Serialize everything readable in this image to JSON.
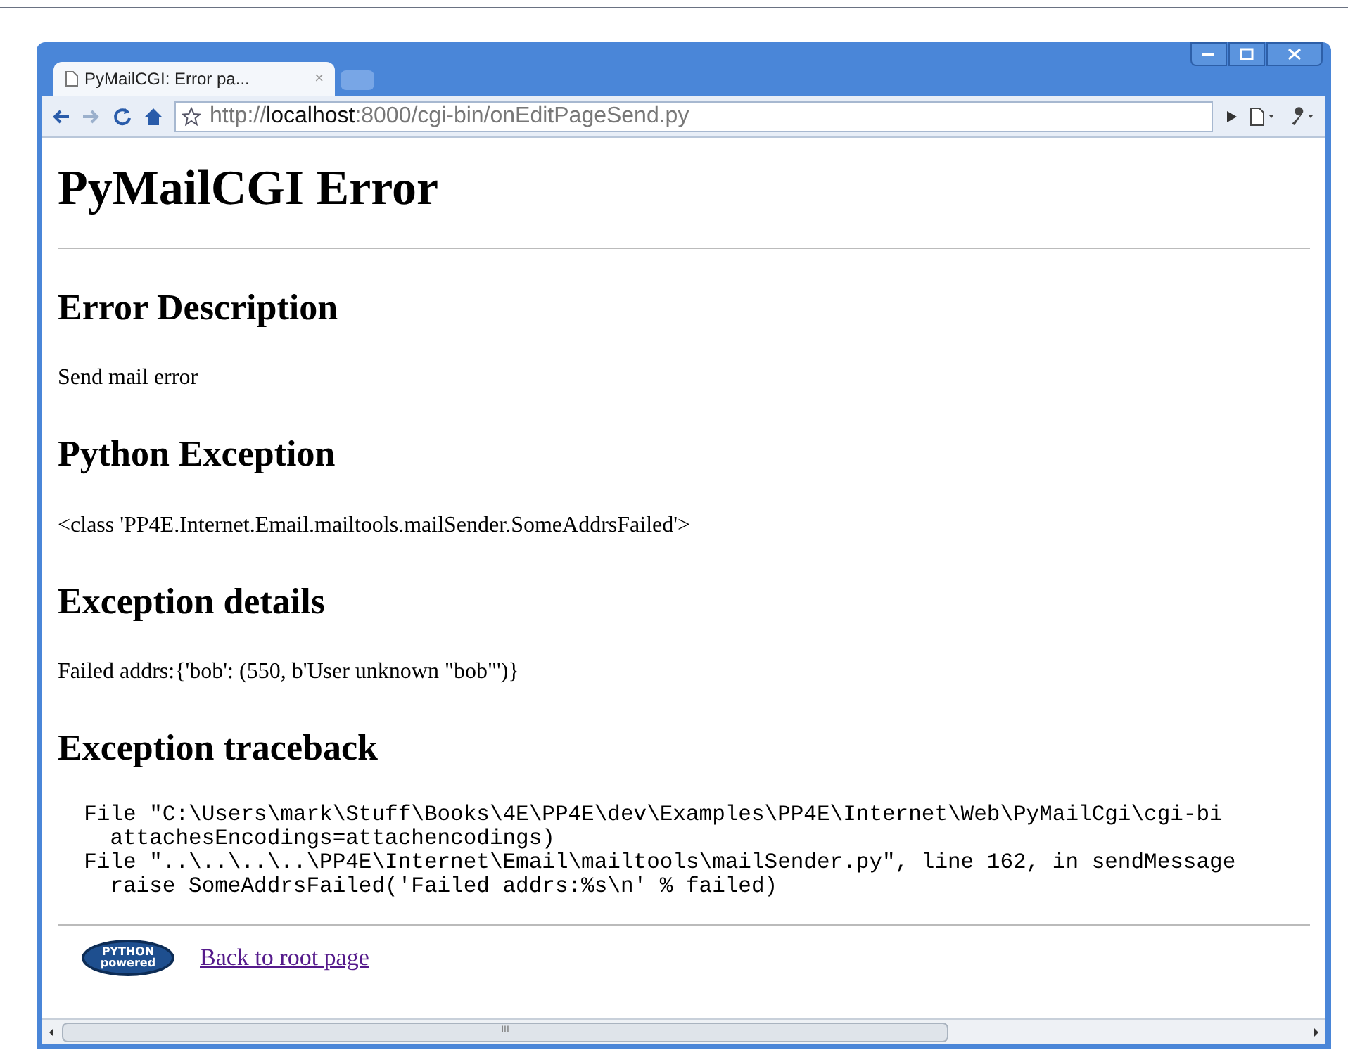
{
  "window": {
    "title": "PyMailCGI: Error pa...",
    "close": "×",
    "url": {
      "scheme": "http://",
      "host": "localhost",
      "path": ":8000/cgi-bin/onEditPageSend.py"
    }
  },
  "page": {
    "title": "PyMailCGI Error",
    "sections": [
      {
        "heading": "Error Description",
        "kind": "text",
        "body": [
          "Send mail error"
        ]
      },
      {
        "heading": "Python Exception",
        "kind": "text",
        "body": [
          "<class 'PP4E.Internet.Email.mailtools.mailSender.SomeAddrsFailed'>"
        ]
      },
      {
        "heading": "Exception details",
        "kind": "text",
        "body": [
          "Failed addrs:{'bob': (550, b'User unknown \"bob\"')}"
        ]
      },
      {
        "heading": "Exception traceback",
        "kind": "code",
        "body": [
          "  File \"C:\\Users\\mark\\Stuff\\Books\\4E\\PP4E\\dev\\Examples\\PP4E\\Internet\\Web\\PyMailCgi\\cgi-bi",
          "    attachesEncodings=attachencodings)",
          "  File \"..\\..\\..\\..\\PP4E\\Internet\\Email\\mailtools\\mailSender.py\", line 162, in sendMessage",
          "    raise SomeAddrsFailed('Failed addrs:%s\\n' % failed)"
        ]
      }
    ],
    "footer": {
      "logo": [
        "PYTHON",
        "powered"
      ],
      "link": "Back to root page"
    }
  },
  "scrollbar": {
    "grip": "III"
  }
}
